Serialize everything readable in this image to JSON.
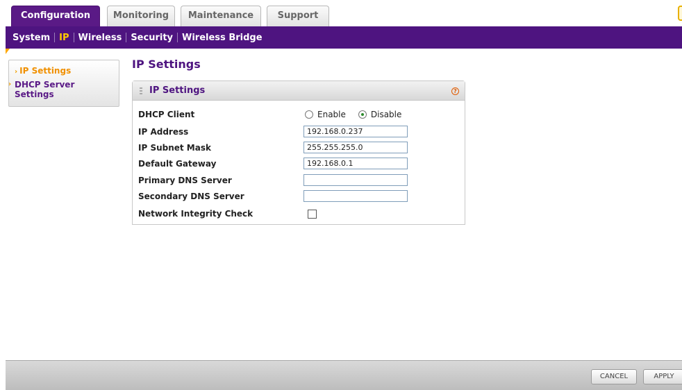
{
  "tabs": [
    {
      "label": "Configuration",
      "active": true
    },
    {
      "label": "Monitoring",
      "active": false
    },
    {
      "label": "Maintenance",
      "active": false
    },
    {
      "label": "Support",
      "active": false
    }
  ],
  "subnav": {
    "items": [
      {
        "label": "System",
        "active": false
      },
      {
        "label": "IP",
        "active": true
      },
      {
        "label": "Wireless",
        "active": false
      },
      {
        "label": "Security",
        "active": false
      },
      {
        "label": "Wireless Bridge",
        "active": false
      }
    ]
  },
  "sidebar": {
    "items": [
      {
        "label": "IP Settings",
        "active": true
      },
      {
        "label": "DHCP Server Settings",
        "active": false
      }
    ]
  },
  "page": {
    "title": "IP Settings",
    "panel_title": "IP Settings",
    "help_glyph": "?"
  },
  "form": {
    "dhcp_client": {
      "label": "DHCP Client",
      "options": [
        "Enable",
        "Disable"
      ],
      "selected": "Disable"
    },
    "ip_address": {
      "label": "IP Address",
      "value": "192.168.0.237"
    },
    "subnet_mask": {
      "label": "IP Subnet Mask",
      "value": "255.255.255.0"
    },
    "gateway": {
      "label": "Default Gateway",
      "value": "192.168.0.1"
    },
    "primary_dns": {
      "label": "Primary DNS Server",
      "value": ""
    },
    "secondary_dns": {
      "label": "Secondary DNS Server",
      "value": ""
    },
    "integrity_check": {
      "label": "Network Integrity Check",
      "checked": false
    }
  },
  "footer": {
    "cancel_label": "CANCEL",
    "apply_label": "APPLY"
  },
  "colors": {
    "brand_purple": "#4e1480",
    "active_tab": "#5a1a86",
    "active_accent": "#f09000"
  },
  "icons": [
    "help-icon",
    "menu-arrow-icon",
    "panel-grip-icon"
  ]
}
